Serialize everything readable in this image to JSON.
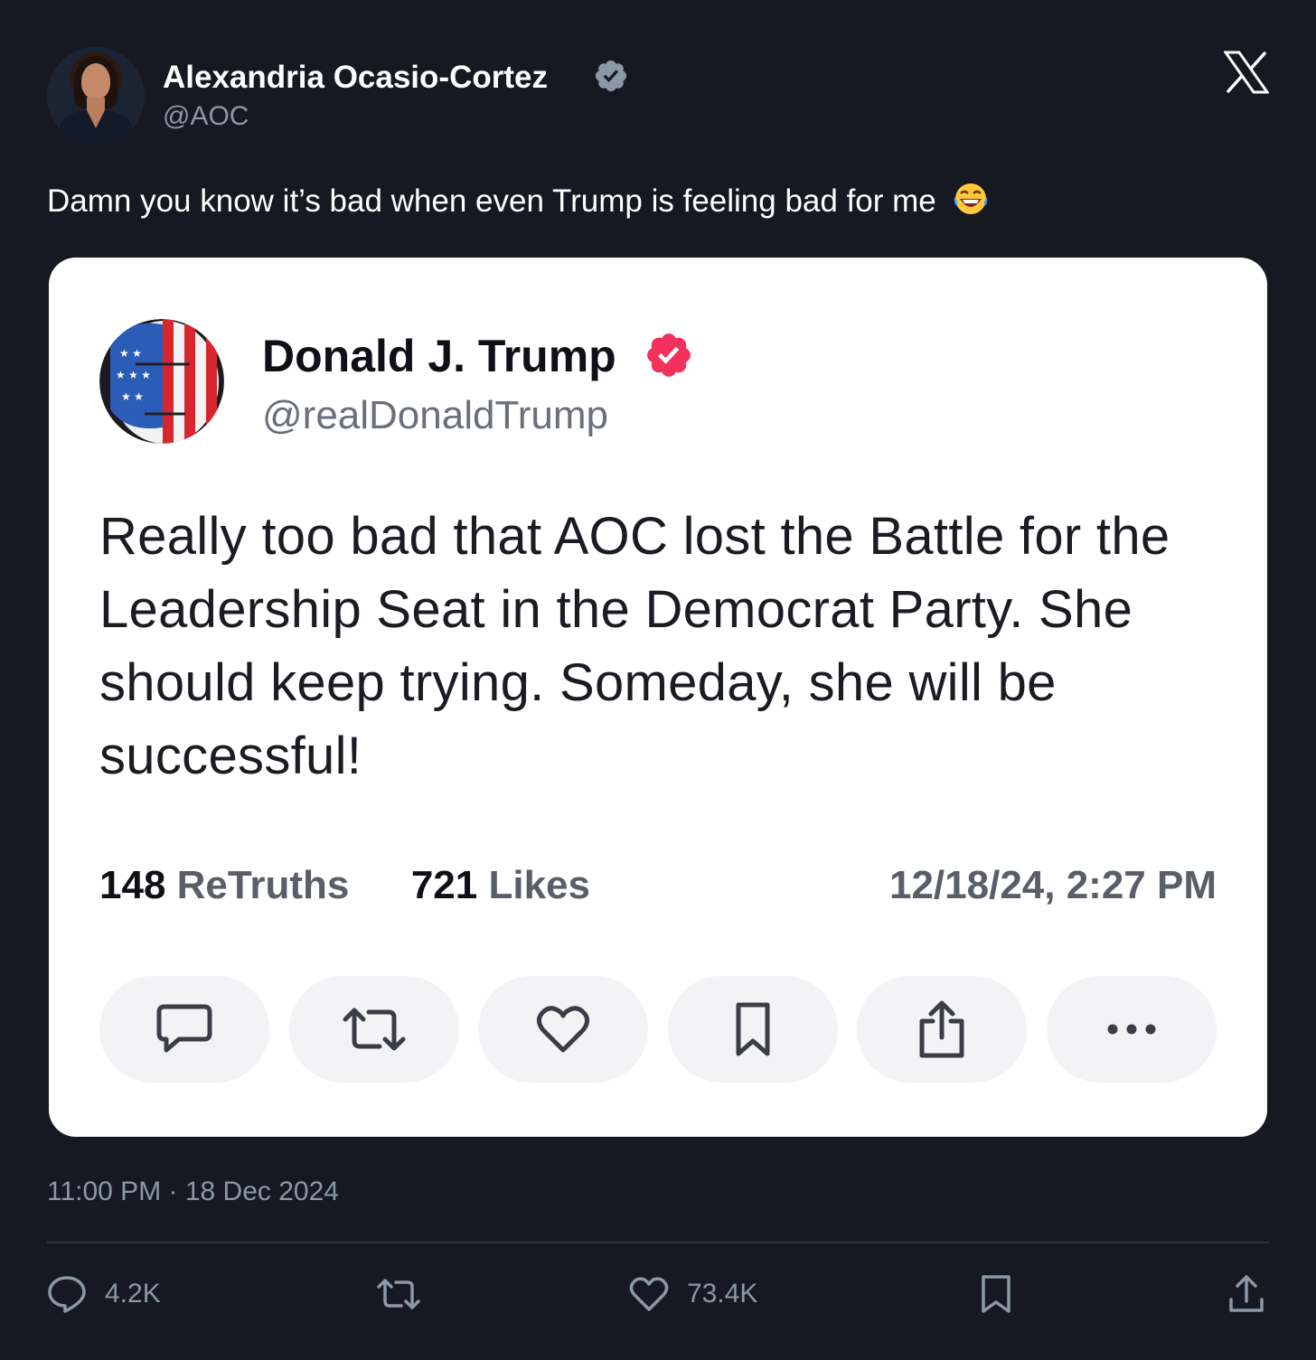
{
  "author": {
    "name": "Alexandria Ocasio-Cortez",
    "handle": "@AOC",
    "verified": true
  },
  "platform_logo": "x-logo-icon",
  "tweet_text": "Damn you know it’s bad when even Trump is feeling bad for me",
  "tweet_emoji": "face-with-tears-of-joy",
  "embedded_post": {
    "name": "Donald J. Trump",
    "handle": "@realDonaldTrump",
    "verified_color": "#f2325c",
    "body": "Really too bad that AOC lost the Battle for the Leadership Seat in the Democrat Party. She should keep trying. Someday, she will be successful!",
    "retruths_count": "148",
    "retruths_label": "ReTruths",
    "likes_count": "721",
    "likes_label": "Likes",
    "timestamp": "12/18/24, 2:27 PM",
    "actions": [
      "reply-icon",
      "retruth-icon",
      "like-icon",
      "bookmark-icon",
      "share-icon",
      "more-icon"
    ]
  },
  "timestamp": "11:00 PM · 18 Dec 2024",
  "stats": {
    "replies": "4.2K",
    "reposts": "",
    "likes": "73.4K"
  },
  "colors": {
    "background": "#161922",
    "text_secondary": "#8b98a5",
    "verified_badge": "#8b98a5"
  }
}
